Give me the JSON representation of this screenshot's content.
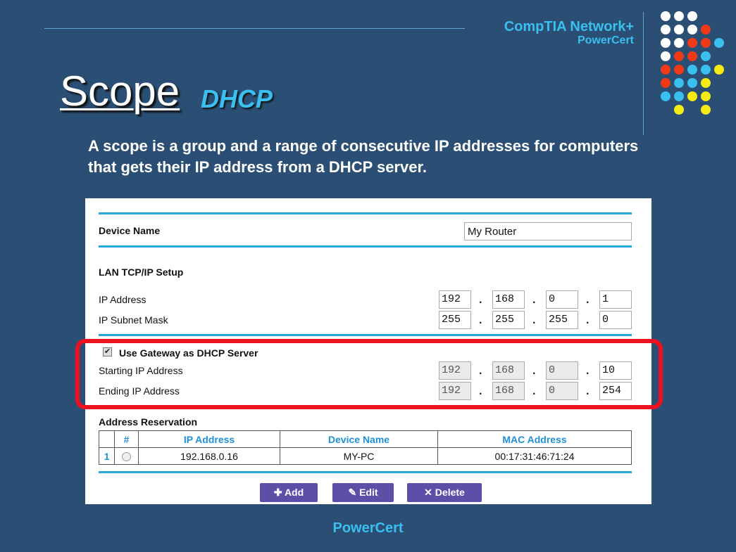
{
  "header": {
    "brand_line1": "CompTIA Network+",
    "brand_line2": "PowerCert"
  },
  "slide": {
    "title": "Scope",
    "subtitle": "DHCP",
    "description": "A scope is a group and a range of consecutive IP addresses for computers that gets their IP address from a DHCP server."
  },
  "router": {
    "device_name_label": "Device Name",
    "device_name_value": "My Router",
    "lan_section_label": "LAN TCP/IP Setup",
    "ip_address_label": "IP Address",
    "ip_address": [
      "192",
      "168",
      "0",
      "1"
    ],
    "subnet_label": "IP Subnet Mask",
    "subnet": [
      "255",
      "255",
      "255",
      "0"
    ],
    "dhcp_checkbox_label": "Use Gateway as DHCP Server",
    "dhcp_checked": true,
    "start_label": "Starting IP Address",
    "start_ip": [
      "192",
      "168",
      "0",
      "10"
    ],
    "end_label": "Ending IP Address",
    "end_ip": [
      "192",
      "168",
      "0",
      "254"
    ],
    "reservation_label": "Address Reservation",
    "table_headers": [
      "",
      "#",
      "IP Address",
      "Device Name",
      "MAC Address"
    ],
    "table_rows": [
      {
        "index": "1",
        "ip": "192.168.0.16",
        "device": "MY-PC",
        "mac": "00:17:31:46:71:24"
      }
    ],
    "add_label": "Add",
    "edit_label": "Edit",
    "delete_label": "Delete"
  },
  "footer": {
    "text": "PowerCert"
  },
  "colors": {
    "background": "#2b4f74",
    "accent_blue": "#39bff0",
    "button_purple": "#5c4fa8",
    "highlight_red": "#ef1020"
  }
}
